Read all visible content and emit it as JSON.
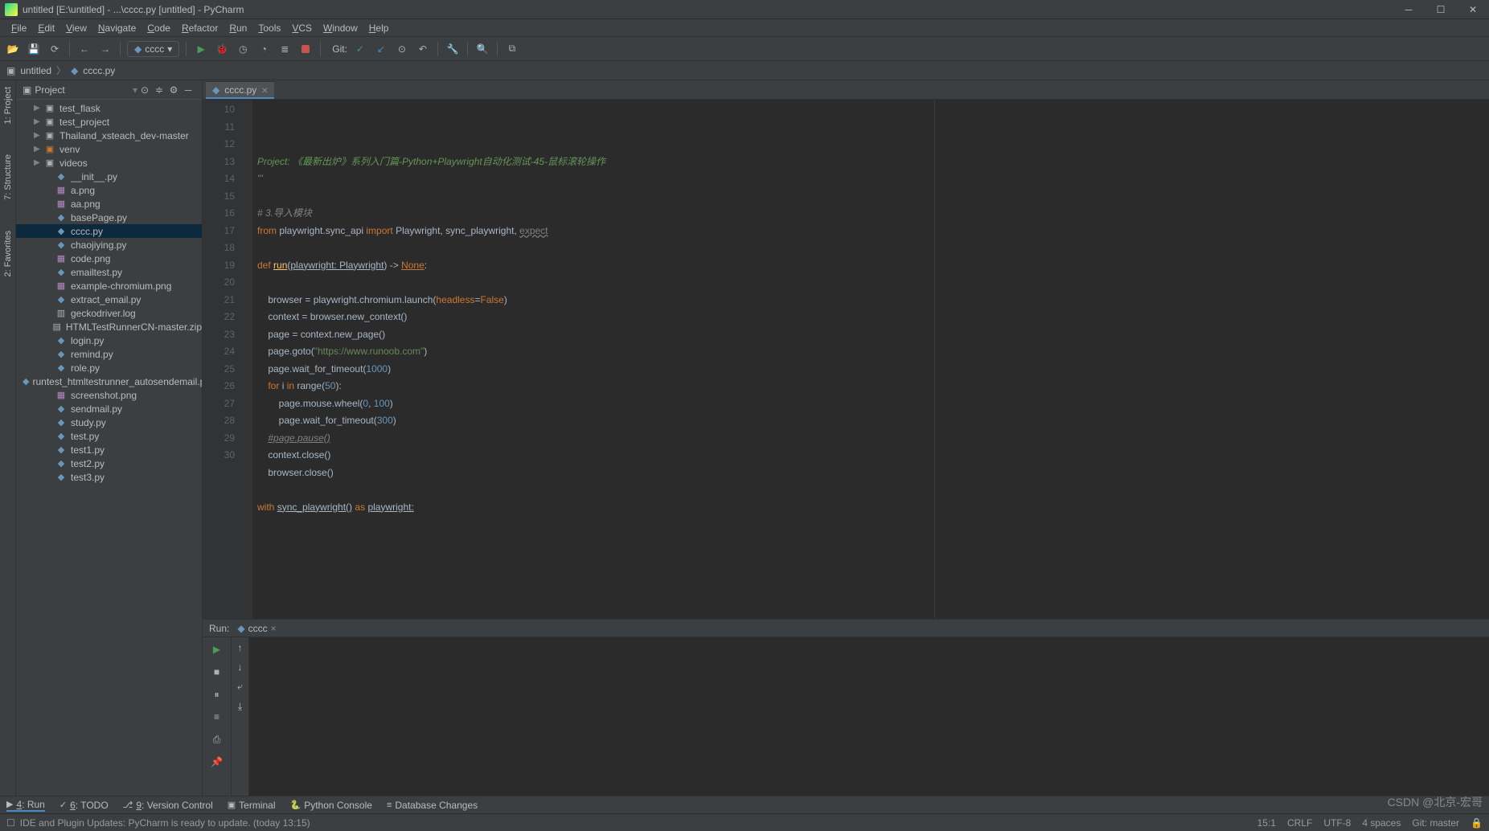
{
  "window": {
    "title": "untitled [E:\\untitled] - ...\\cccc.py [untitled] - PyCharm"
  },
  "menu": [
    "File",
    "Edit",
    "View",
    "Navigate",
    "Code",
    "Refactor",
    "Run",
    "Tools",
    "VCS",
    "Window",
    "Help"
  ],
  "toolbar": {
    "run_config": "cccc",
    "git_label": "Git:"
  },
  "breadcrumb": {
    "root": "untitled",
    "file": "cccc.py"
  },
  "project_panel": {
    "title": "Project",
    "tree": [
      {
        "depth": 1,
        "arrow": "▶",
        "icon": "folder",
        "label": "test_flask"
      },
      {
        "depth": 1,
        "arrow": "▶",
        "icon": "folder",
        "label": "test_project"
      },
      {
        "depth": 1,
        "arrow": "▶",
        "icon": "folder",
        "label": "Thailand_xsteach_dev-master"
      },
      {
        "depth": 1,
        "arrow": "▶",
        "icon": "folder-open",
        "label": "venv"
      },
      {
        "depth": 1,
        "arrow": "▶",
        "icon": "folder",
        "label": "videos"
      },
      {
        "depth": 2,
        "arrow": "",
        "icon": "py",
        "label": "__init__.py"
      },
      {
        "depth": 2,
        "arrow": "",
        "icon": "img",
        "label": "a.png"
      },
      {
        "depth": 2,
        "arrow": "",
        "icon": "img",
        "label": "aa.png"
      },
      {
        "depth": 2,
        "arrow": "",
        "icon": "py",
        "label": "basePage.py"
      },
      {
        "depth": 2,
        "arrow": "",
        "icon": "py",
        "label": "cccc.py",
        "selected": true
      },
      {
        "depth": 2,
        "arrow": "",
        "icon": "py",
        "label": "chaojiying.py"
      },
      {
        "depth": 2,
        "arrow": "",
        "icon": "img",
        "label": "code.png"
      },
      {
        "depth": 2,
        "arrow": "",
        "icon": "py",
        "label": "emailtest.py"
      },
      {
        "depth": 2,
        "arrow": "",
        "icon": "img",
        "label": "example-chromium.png"
      },
      {
        "depth": 2,
        "arrow": "",
        "icon": "py",
        "label": "extract_email.py"
      },
      {
        "depth": 2,
        "arrow": "",
        "icon": "txt",
        "label": "geckodriver.log"
      },
      {
        "depth": 2,
        "arrow": "",
        "icon": "zip",
        "label": "HTMLTestRunnerCN-master.zip"
      },
      {
        "depth": 2,
        "arrow": "",
        "icon": "py",
        "label": "login.py"
      },
      {
        "depth": 2,
        "arrow": "",
        "icon": "py",
        "label": "remind.py"
      },
      {
        "depth": 2,
        "arrow": "",
        "icon": "py",
        "label": "role.py"
      },
      {
        "depth": 2,
        "arrow": "",
        "icon": "py",
        "label": "runtest_htmltestrunner_autosendemail.py"
      },
      {
        "depth": 2,
        "arrow": "",
        "icon": "img",
        "label": "screenshot.png"
      },
      {
        "depth": 2,
        "arrow": "",
        "icon": "py",
        "label": "sendmail.py"
      },
      {
        "depth": 2,
        "arrow": "",
        "icon": "py",
        "label": "study.py"
      },
      {
        "depth": 2,
        "arrow": "",
        "icon": "py",
        "label": "test.py"
      },
      {
        "depth": 2,
        "arrow": "",
        "icon": "py",
        "label": "test1.py"
      },
      {
        "depth": 2,
        "arrow": "",
        "icon": "py",
        "label": "test2.py"
      },
      {
        "depth": 2,
        "arrow": "",
        "icon": "py",
        "label": "test3.py"
      }
    ]
  },
  "left_tabs": [
    "1: Project",
    "7: Structure",
    "2: Favorites"
  ],
  "editor": {
    "tab_name": "cccc.py",
    "first_line": 10,
    "lines": [
      {
        "n": 10,
        "html": "<span class='c-doc'>Project: 《最新出炉》系列入门篇-Python+Playwright自动化测试-45-鼠标滚轮操作</span>"
      },
      {
        "n": 11,
        "html": "<span class='c-doc'>'''</span>"
      },
      {
        "n": 12,
        "html": ""
      },
      {
        "n": 13,
        "html": "<span class='c-comment'># 3.导入模块</span>"
      },
      {
        "n": 14,
        "html": "<span class='c-key'>from</span> playwright.sync_api <span class='c-key'>import</span> Playwright, sync_playwright, <span class='c-unused'>expect</span>"
      },
      {
        "n": 15,
        "html": ""
      },
      {
        "n": 16,
        "html": "<span class='c-key'>def</span> <span class='c-def c-underline'>run</span>(<span class='c-underline'>playwright: Playwright</span>) -&gt; <span class='c-key c-underline'>None</span>:"
      },
      {
        "n": 17,
        "html": ""
      },
      {
        "n": 18,
        "html": "    browser = playwright.chromium.launch(<span class='c-param'>headless</span>=<span class='c-key'>False</span>)"
      },
      {
        "n": 19,
        "html": "    context = browser.new_context()"
      },
      {
        "n": 20,
        "html": "    page = context.new_page()"
      },
      {
        "n": 21,
        "html": "    page.goto(<span class='c-str'>\"https://www.runoob.com\"</span>)"
      },
      {
        "n": 22,
        "html": "    page.wait_for_timeout(<span class='c-num'>1000</span>)"
      },
      {
        "n": 23,
        "html": "    <span class='c-key'>for</span> i <span class='c-key'>in</span> range(<span class='c-num'>50</span>):"
      },
      {
        "n": 24,
        "html": "        page.mouse.wheel(<span class='c-num'>0</span>, <span class='c-num'>100</span>)"
      },
      {
        "n": 25,
        "html": "        page.wait_for_timeout(<span class='c-num'>300</span>)"
      },
      {
        "n": 26,
        "html": "    <span class='c-comment c-underline'>#page.pause()</span>"
      },
      {
        "n": 27,
        "html": "    context.close()"
      },
      {
        "n": 28,
        "html": "    browser.close()"
      },
      {
        "n": 29,
        "html": ""
      },
      {
        "n": 30,
        "html": "<span class='c-key'>with</span> <span class='c-underline'>sync_playwright()</span> <span class='c-key'>as</span> <span class='c-underline'>playwright:</span>"
      }
    ]
  },
  "run_panel": {
    "label": "Run:",
    "tab": "cccc"
  },
  "bottom_tabs": [
    {
      "icon": "▶",
      "label": "4: Run",
      "underline": "4"
    },
    {
      "icon": "✓",
      "label": "6: TODO",
      "underline": "6"
    },
    {
      "icon": "⎇",
      "label": "9: Version Control",
      "underline": "9"
    },
    {
      "icon": "▣",
      "label": "Terminal"
    },
    {
      "icon": "🐍",
      "label": "Python Console"
    },
    {
      "icon": "≡",
      "label": "Database Changes"
    }
  ],
  "status": {
    "left_icon": "☐",
    "message": "IDE and Plugin Updates: PyCharm is ready to update. (today 13:15)",
    "pos": "15:1",
    "crlf": "CRLF",
    "encoding": "UTF-8",
    "indent": "4 spaces",
    "branch": "Git: master",
    "lock": "🔒"
  },
  "watermark": "CSDN @北京-宏哥"
}
